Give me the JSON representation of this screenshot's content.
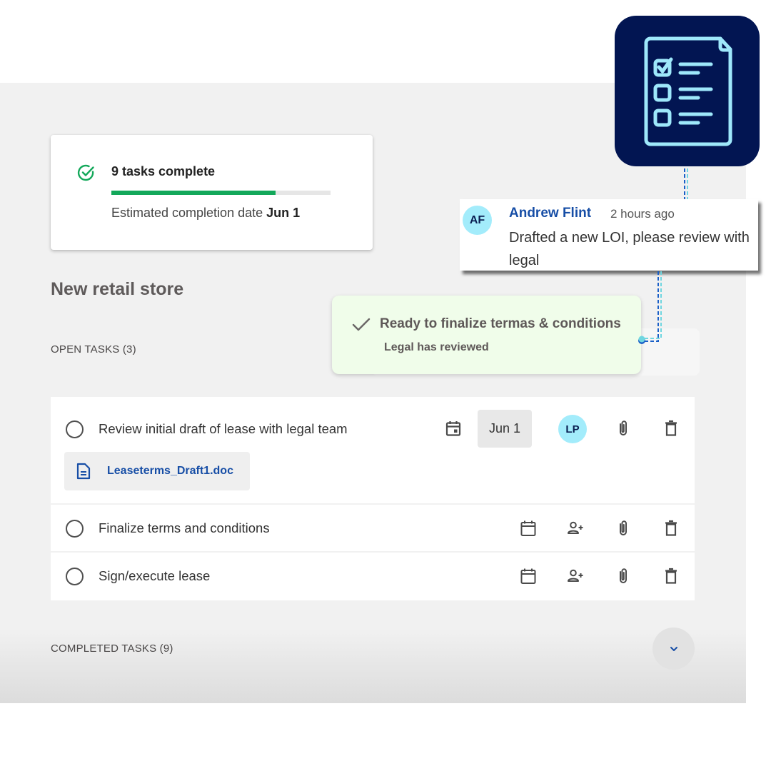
{
  "summary": {
    "tasks_complete": "9 tasks complete",
    "progress_fraction": 0.75,
    "estimated_label": "Estimated completion date",
    "estimated_date": "Jun 1",
    "colors": {
      "success": "#13a85a",
      "track": "#e6e6e6"
    }
  },
  "project": {
    "title": "New retail store"
  },
  "open_tasks": {
    "label": "OPEN TASKS (3)",
    "items": [
      {
        "text": "Review initial draft of lease with legal team",
        "due_date": "Jun 1",
        "assignee_initials": "LP",
        "attachment": "Leaseterms_Draft1.doc"
      },
      {
        "text": "Finalize terms and conditions"
      },
      {
        "text": "Sign/execute lease"
      }
    ]
  },
  "completed_tasks": {
    "label": "COMPLETED TASKS (9)"
  },
  "toast": {
    "title": "Ready to finalize termas & conditions",
    "subtitle": "Legal has reviewed",
    "background": "#f0fdea"
  },
  "comment": {
    "initials": "AF",
    "author": "Andrew Flint",
    "time": "2 hours ago",
    "body": "Drafted a new LOI, please review with legal"
  },
  "app_icon": {
    "name": "checklist-document-icon",
    "background": "#021552",
    "stroke": "#9ee8fb"
  },
  "icons": {
    "calendar": "calendar-icon",
    "add_person": "add-person-icon",
    "attach": "paperclip-icon",
    "delete": "trash-icon",
    "expand": "chevron-down-icon"
  }
}
